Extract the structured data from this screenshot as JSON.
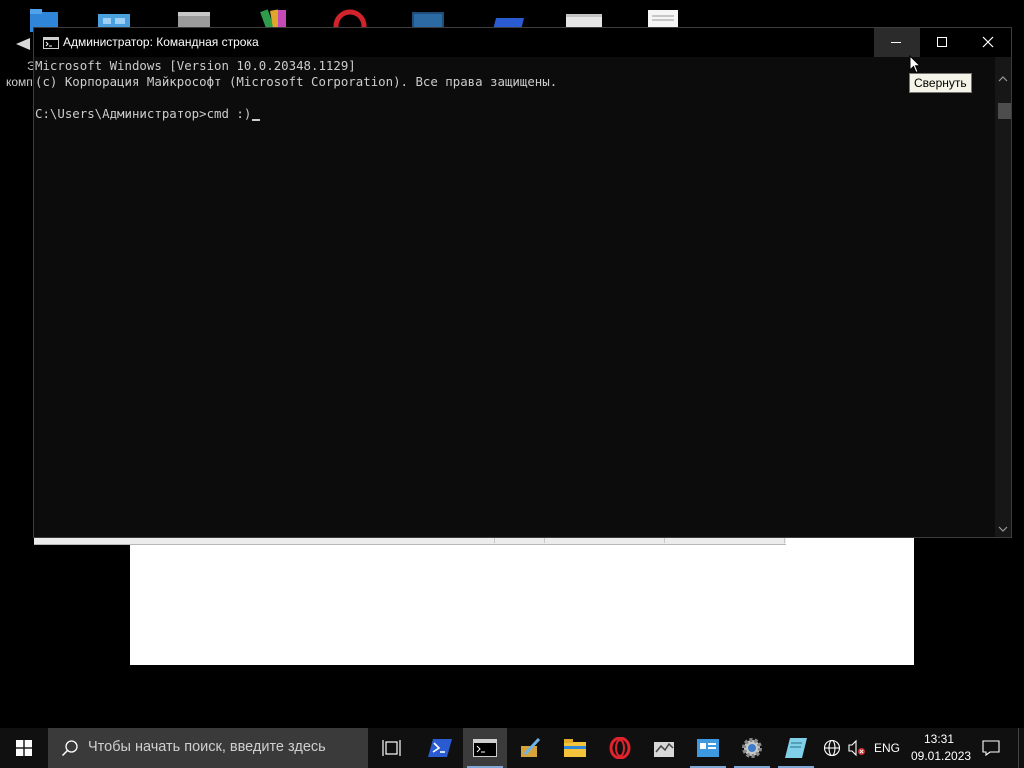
{
  "window": {
    "title": "Администратор: Командная строка",
    "buttons": {
      "minimize": "minimize",
      "maximize": "maximize",
      "close": "close"
    }
  },
  "console": {
    "lines": [
      "Microsoft Windows [Version 10.0.20348.1129]",
      "(c) Корпорация Майкрософт (Microsoft Corporation). Все права защищены.",
      "",
      "C:\\Users\\Администратор>cmd :)"
    ]
  },
  "tooltip": {
    "text": "Свернуть"
  },
  "desktop": {
    "partial_labels": [
      "Э",
      "комп"
    ],
    "icons": [
      "folder-icon",
      "control-panel-icon",
      "disk-icon",
      "books-icon",
      "opera-icon",
      "terminal-icon",
      "powershell-icon",
      "settings-window-icon",
      "notepad-icon"
    ]
  },
  "taskbar": {
    "search_placeholder": "Чтобы начать поиск, введите здесь",
    "apps": [
      {
        "name": "task-view-icon",
        "active": false
      },
      {
        "name": "powershell-icon",
        "active": false
      },
      {
        "name": "cmd-icon",
        "active": true
      },
      {
        "name": "pen-app-icon",
        "active": false
      },
      {
        "name": "file-explorer-icon",
        "active": false
      },
      {
        "name": "opera-icon",
        "active": false
      },
      {
        "name": "remote-desktop-icon",
        "active": false
      },
      {
        "name": "server-manager-icon",
        "active": true
      },
      {
        "name": "settings-icon",
        "active": true
      },
      {
        "name": "notepad-app-icon",
        "active": true
      }
    ],
    "tray": {
      "language": "ENG",
      "time": "13:31",
      "date": "09.01.2023"
    }
  },
  "colors": {
    "console_bg": "#0c0c0c",
    "console_text": "#cccccc",
    "taskbar_bg": "#101010",
    "accent": "#7fa8d6"
  }
}
